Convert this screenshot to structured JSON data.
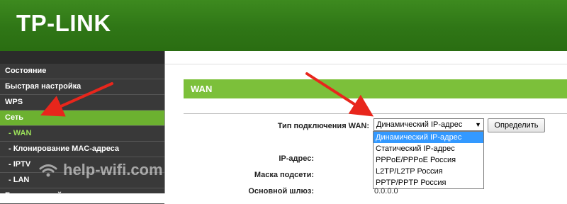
{
  "brand": {
    "logo_text": "TP-LINK",
    "header_color": "#2f7616",
    "accent_color": "#6cb130"
  },
  "sidebar": {
    "items": [
      {
        "label": "Состояние",
        "active": false,
        "sub": false
      },
      {
        "label": "Быстрая настройка",
        "active": false,
        "sub": false
      },
      {
        "label": "WPS",
        "active": false,
        "sub": false
      },
      {
        "label": "Сеть",
        "active": true,
        "sub": false
      },
      {
        "label": "- WAN",
        "active": false,
        "sub": true,
        "current": true
      },
      {
        "label": "- Клонирование MAC-адреса",
        "active": false,
        "sub": true
      },
      {
        "label": "- IPTV",
        "active": false,
        "sub": true
      },
      {
        "label": "- LAN",
        "active": false,
        "sub": true
      },
      {
        "label": "Беспроводной режим",
        "active": false,
        "sub": false
      }
    ]
  },
  "main": {
    "section_title": "WAN",
    "connection_type_label": "Тип подключения WAN:",
    "connection_type_value": "Динамический IP-адрес",
    "detect_button": "Определить",
    "dropdown_options": [
      {
        "label": "Динамический IP-адрес",
        "selected": true
      },
      {
        "label": "Статический IP-адрес",
        "selected": false
      },
      {
        "label": "PPPoE/PPPoE Россия",
        "selected": false
      },
      {
        "label": "L2TP/L2TP Россия",
        "selected": false
      },
      {
        "label": "PPTP/PPTP Россия",
        "selected": false
      }
    ],
    "ip_label": "IP-адрес:",
    "mask_label": "Маска подсети:",
    "gateway_label": "Основной шлюз:",
    "gateway_value": "0.0.0.0"
  },
  "watermark": {
    "text": "help-wifi.com",
    "icon": "wifi-icon"
  },
  "annotations": {
    "arrow_color": "#e8261c"
  }
}
